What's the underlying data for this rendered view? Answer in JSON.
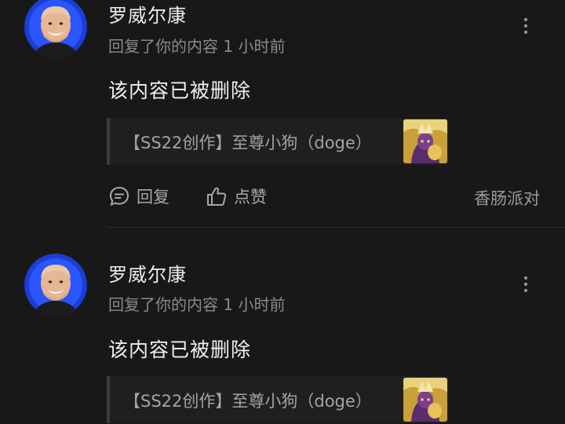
{
  "comments": [
    {
      "username": "罗威尔康",
      "meta": "回复了你的内容 1 小时前",
      "content": "该内容已被删除",
      "quote": "【SS22创作】至尊小狗（doge）",
      "actions": {
        "reply": "回复",
        "like": "点赞",
        "source": "香肠派对"
      }
    },
    {
      "username": "罗威尔康",
      "meta": "回复了你的内容 1 小时前",
      "content": "该内容已被删除",
      "quote": "【SS22创作】至尊小狗（doge）"
    }
  ],
  "colors": {
    "background": "#181818",
    "primary_text": "#ececec",
    "secondary_text": "#8a8a8a",
    "quote_bg": "#1f1f1f",
    "avatar_ring": "#1a3fd6"
  },
  "icons": {
    "more": "more-vertical-icon",
    "reply": "chat-bubble-icon",
    "like": "thumbs-up-icon"
  }
}
